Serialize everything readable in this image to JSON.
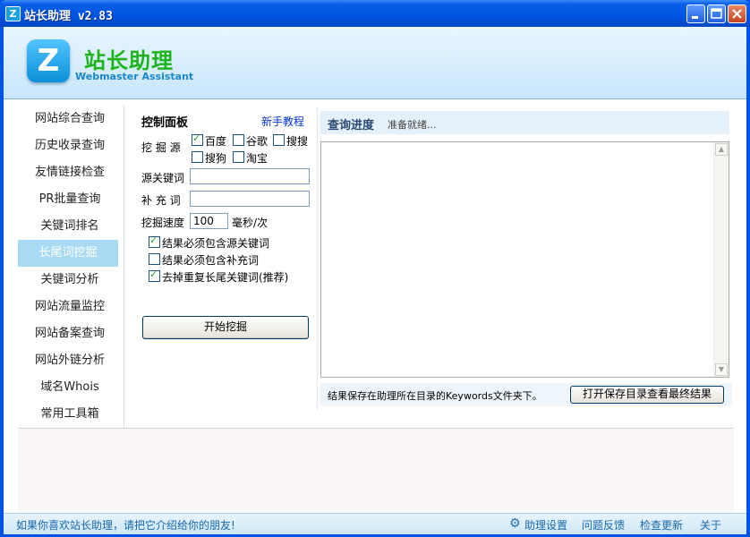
{
  "window": {
    "title": "站长助理 v2.83",
    "icon_letter": "Z"
  },
  "header": {
    "logo_letter": "Z",
    "title": "站长助理",
    "subtitle": "Webmaster Assistant"
  },
  "sidebar": {
    "items": [
      {
        "label": "网站综合查询"
      },
      {
        "label": "历史收录查询"
      },
      {
        "label": "友情链接检查"
      },
      {
        "label": "PR批量查询"
      },
      {
        "label": "关键词排名"
      },
      {
        "label": "长尾词挖掘",
        "active": true
      },
      {
        "label": "关键词分析"
      },
      {
        "label": "网站流量监控"
      },
      {
        "label": "网站备案查询"
      },
      {
        "label": "网站外链分析"
      },
      {
        "label": "域名Whois"
      },
      {
        "label": "常用工具箱"
      }
    ]
  },
  "panel": {
    "title": "控制面板",
    "tutorial_link": "新手教程",
    "source_label": "挖 掘 源",
    "sources": [
      {
        "label": "百度",
        "checked": true
      },
      {
        "label": "谷歌",
        "checked": false
      },
      {
        "label": "搜搜",
        "checked": false
      },
      {
        "label": "搜狗",
        "checked": false
      },
      {
        "label": "淘宝",
        "checked": false
      }
    ],
    "source_keyword_label": "源关键词",
    "source_keyword_value": "",
    "supplement_label": "补 充 词",
    "supplement_value": "",
    "speed_label": "挖掘速度",
    "speed_value": "100",
    "speed_unit": "毫秒/次",
    "options": [
      {
        "label": "结果必须包含源关键词",
        "checked": true
      },
      {
        "label": "结果必须包含补充词",
        "checked": false
      },
      {
        "label": "去掉重复长尾关键词(推荐)",
        "checked": true
      }
    ],
    "start_button": "开始挖掘"
  },
  "progress": {
    "title": "查询进度",
    "status": "准备就绪...",
    "result_text": ""
  },
  "results_footer": {
    "note": "结果保存在助理所在目录的Keywords文件夹下。",
    "open_button": "打开保存目录查看最终结果"
  },
  "statusbar": {
    "share_text": "如果你喜欢站长助理，请把它介绍给你的朋友!",
    "settings": "助理设置",
    "feedback": "问题反馈",
    "update": "检查更新",
    "about": "关于"
  }
}
